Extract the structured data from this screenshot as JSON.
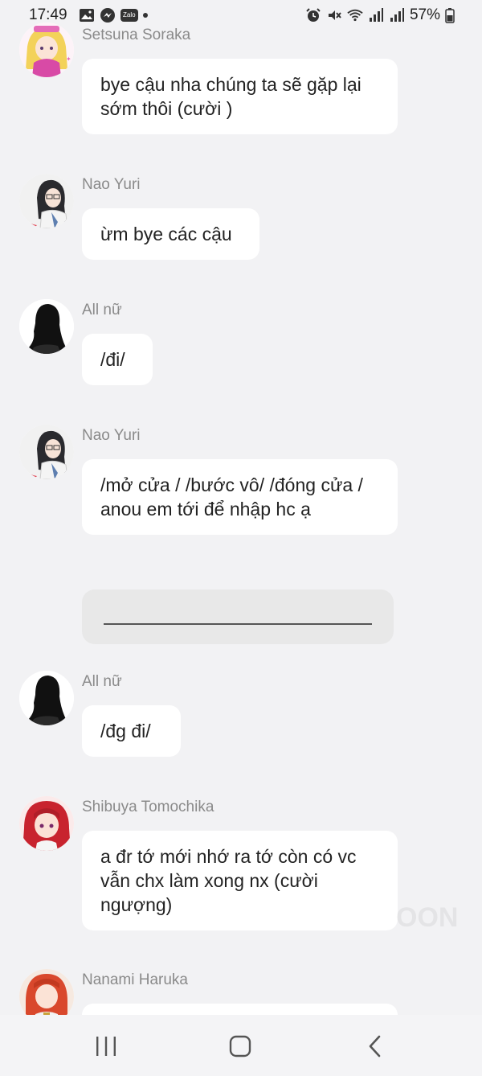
{
  "status_bar": {
    "time": "17:49",
    "battery": "57%",
    "zalo_label": "Zalo",
    "icons": [
      "gallery-icon",
      "messenger-icon",
      "zalo-icon",
      "notification-dot-icon",
      "alarm-icon",
      "mute-icon",
      "wifi-icon",
      "signal-icon",
      "signal-icon",
      "battery-icon"
    ]
  },
  "messages": [
    {
      "sender": "Setsuna Soraka",
      "text": "bye cậu nha chúng ta sẽ gặp lại sớm thôi (cười )",
      "avatar": "blonde-pink-hair-avatar"
    },
    {
      "sender": "Nao Yuri",
      "text": "ừm bye các cậu",
      "avatar": "dark-hair-glasses-avatar"
    },
    {
      "sender": "All nữ",
      "text": "/đi/",
      "avatar": "silhouette-avatar"
    },
    {
      "sender": "Nao Yuri",
      "text": "/mở cửa / /bước vô/ /đóng cửa / anou em tới để nhập hc ạ",
      "avatar": "dark-hair-glasses-avatar"
    },
    {
      "sender": "All nữ",
      "text": "/đg đi/",
      "avatar": "silhouette-avatar"
    },
    {
      "sender": "Shibuya Tomochika",
      "text": "a đr tớ mới nhớ ra tớ còn có vc vẫn chx làm xong nx (cười ngượng)",
      "avatar": "red-hair-avatar"
    },
    {
      "sender": "Nanami Haruka",
      "text": "",
      "avatar": "orange-hair-avatar"
    }
  ],
  "watermark": "OON",
  "colors": {
    "background": "#f2f2f4",
    "bubble": "#ffffff",
    "name": "#8a8a8a",
    "divider_bubble": "#e8e8e8"
  }
}
